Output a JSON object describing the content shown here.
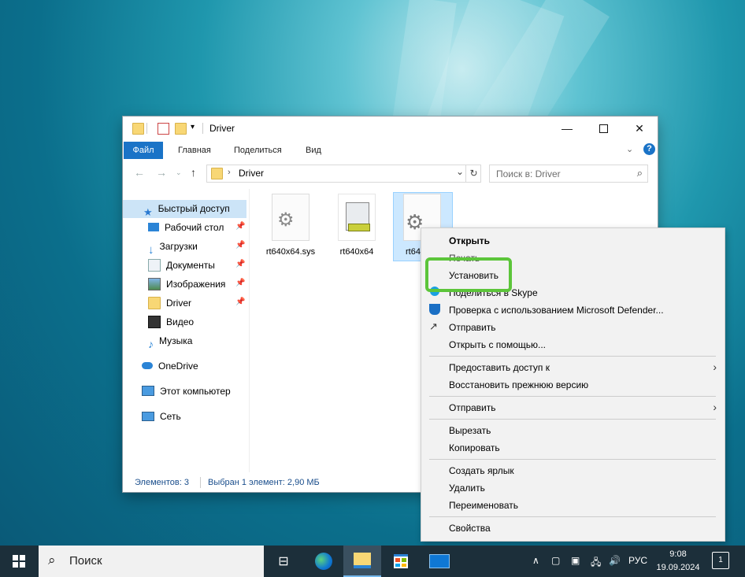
{
  "window": {
    "title": "Driver",
    "controls": [
      "minimize-icon",
      "maximize-icon",
      "close-icon"
    ]
  },
  "ribbon": {
    "tabs": [
      "Файл",
      "Главная",
      "Поделиться",
      "Вид"
    ]
  },
  "address": {
    "path": "Driver",
    "search_placeholder": "Поиск в: Driver"
  },
  "sidebar": {
    "quick_access": "Быстрый доступ",
    "items": [
      "Рабочий стол",
      "Загрузки",
      "Документы",
      "Изображения",
      "Driver",
      "Видео",
      "Музыка"
    ],
    "onedrive": "OneDrive",
    "this_pc": "Этот компьютер",
    "network": "Сеть"
  },
  "files": [
    {
      "name": "rt640x64.sys",
      "icon": "system-file-icon"
    },
    {
      "name": "rt640x64",
      "icon": "catalog-file-icon"
    },
    {
      "name": "rt64",
      "icon": "setup-info-file-icon",
      "selected": true
    }
  ],
  "status": {
    "count": "Элементов: 3",
    "selection": "Выбран 1 элемент: 2,90 МБ"
  },
  "context_menu": {
    "open": "Открыть",
    "print": "Печать",
    "install": "Установить",
    "skype": "Поделиться в Skype",
    "defender": "Проверка с использованием Microsoft Defender...",
    "send": "Отправить",
    "open_with": "Открыть с помощью...",
    "share_access": "Предоставить доступ к",
    "restore": "Восстановить прежнюю версию",
    "send_to": "Отправить",
    "cut": "Вырезать",
    "copy": "Копировать",
    "create_shortcut": "Создать ярлык",
    "delete": "Удалить",
    "rename": "Переименовать",
    "properties": "Свойства"
  },
  "taskbar": {
    "search_label": "Поиск",
    "lang": "РУС",
    "time": "9:08",
    "date": "19.09.2024",
    "notifications": "1"
  },
  "colors": {
    "accent": "#1a73c7",
    "highlight": "#5cc53a",
    "taskbar": "#1c2f3a"
  }
}
